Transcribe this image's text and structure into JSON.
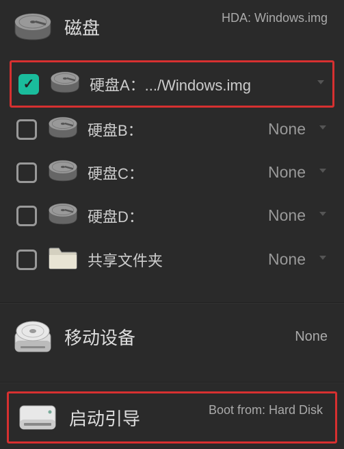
{
  "disk_section": {
    "title": "磁盘",
    "subtitle": "HDA: Windows.img",
    "items": [
      {
        "checked": true,
        "label": "硬盘A：.../Windows.img",
        "value": "",
        "highlighted": true,
        "type": "hdd"
      },
      {
        "checked": false,
        "label": "硬盘B：",
        "value": "None",
        "highlighted": false,
        "type": "hdd"
      },
      {
        "checked": false,
        "label": "硬盘C：",
        "value": "None",
        "highlighted": false,
        "type": "hdd"
      },
      {
        "checked": false,
        "label": "硬盘D：",
        "value": "None",
        "highlighted": false,
        "type": "hdd"
      },
      {
        "checked": false,
        "label": "共享文件夹",
        "value": "None",
        "highlighted": false,
        "type": "folder"
      }
    ]
  },
  "removable_section": {
    "title": "移动设备",
    "value": "None"
  },
  "boot_section": {
    "title": "启动引导",
    "subtitle": "Boot from: Hard Disk",
    "highlighted": true
  }
}
